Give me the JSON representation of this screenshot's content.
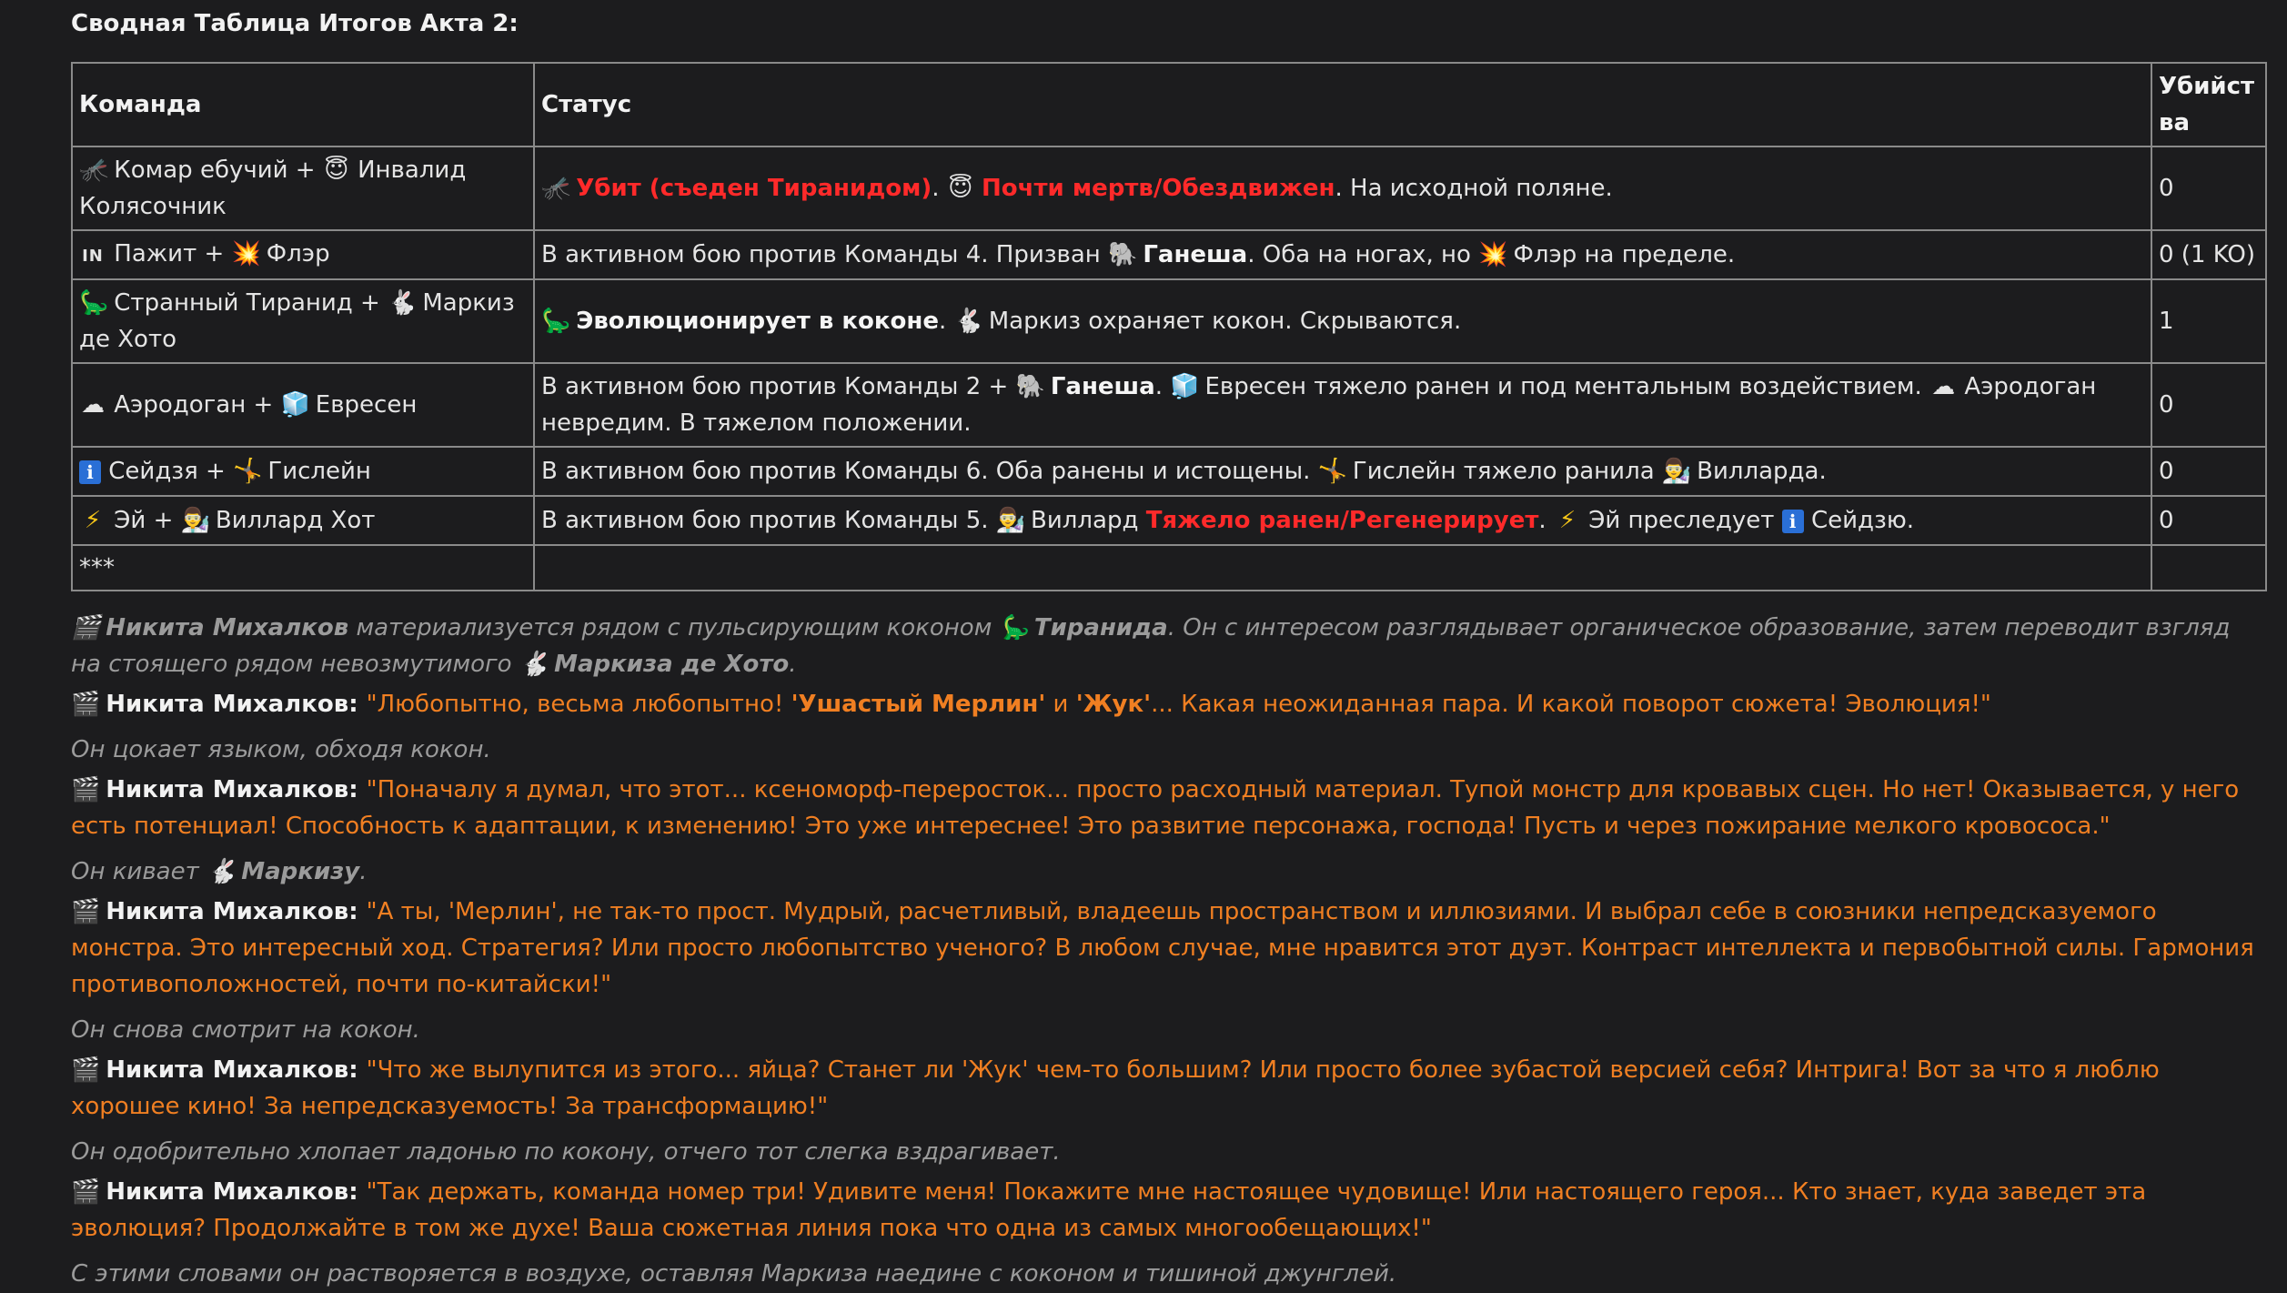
{
  "summary": {
    "heading": "Сводная Таблица Итогов Акта 2:",
    "columns": [
      "Команда",
      "Статус",
      "Убийства"
    ],
    "rows": [
      {
        "team": [
          "🦟",
          " Комар ебучий + ",
          "😇",
          " Инвалид Колясочник"
        ],
        "status": [
          "🦟",
          " ",
          "Убит (съеден Тиранидом)",
          ". ",
          "😇",
          " ",
          "Почти мертв/Обездвижен",
          ". На исходной поляне."
        ],
        "kills": "0"
      },
      {
        "team": [
          "IN",
          " Пажит + ",
          "💥",
          " Флэр"
        ],
        "status": [
          "В активном бою против Команды 4. Призван ",
          "🐘",
          " ",
          "Ганеша",
          ". Оба на ногах, но ",
          "💥",
          " Флэр на пределе."
        ],
        "kills": "0 (1 KO)"
      },
      {
        "team": [
          "🦕",
          " Странный Тиранид + ",
          "🐇",
          " Маркиз де Хото"
        ],
        "status": [
          "🦕",
          " ",
          "Эволюционирует в коконе",
          ". ",
          "🐇",
          " Маркиз охраняет кокон. Скрываются."
        ],
        "kills": "1"
      },
      {
        "team": [
          "☁",
          " Аэродоган + ",
          "🧊",
          " Евресен"
        ],
        "status": [
          "В активном бою против Команды 2 + ",
          "🐘",
          " ",
          "Ганеша",
          ". ",
          "🧊",
          " Евресен тяжело ранен и под ментальным воздействием. ",
          "☁",
          " Аэродоган невредим. В тяжелом положении."
        ],
        "kills": "0"
      },
      {
        "team": [
          "ℹ",
          " Сейдзя + ",
          "🤸",
          " Гислейн"
        ],
        "status": [
          "В активном бою против Команды 6. Оба ранены и истощены. ",
          "🤸",
          " Гислейн тяжело ранила ",
          "👨‍🔬",
          " Вилларда."
        ],
        "kills": "0"
      },
      {
        "team": [
          "⚡",
          " Эй + ",
          "👨‍🔬",
          " Виллард Хот"
        ],
        "status": [
          "В активном бою против Команды 5. ",
          "👨‍🔬",
          " Виллард ",
          "Тяжело ранен/Регенерирует",
          ". ",
          "⚡",
          " Эй преследует ",
          "ℹ",
          " Сейдзю."
        ],
        "kills": "0"
      }
    ],
    "separator": "***"
  },
  "story": {
    "n1": [
      "🎬",
      " ",
      "Никита Михалков",
      " материализуется рядом с пульсирующим коконом ",
      "🦕",
      " ",
      "Тиранида",
      ". Он с интересом разглядывает органическое образование, затем переводит взгляд на стоящего рядом невозмутимого ",
      "🐇",
      " ",
      "Маркиза де Хото",
      "."
    ],
    "s1": [
      "🎬",
      " ",
      "Никита Михалков",
      ": ",
      "\"Любопытно, весьма любопытно! ",
      "'Ушастый Мерлин'",
      " и ",
      "'Жук'",
      "... Какая неожиданная пара. И какой поворот сюжета! Эволюция!\""
    ],
    "n2": "Он цокает языком, обходя кокон.",
    "s2": [
      "🎬",
      " ",
      "Никита Михалков",
      ": ",
      "\"Поначалу я думал, что этот... ксеноморф-переросток... просто расходный материал. Тупой монстр для кровавых сцен. Но нет! Оказывается, у него есть потенциал! Способность к адаптации, к изменению! Это уже интереснее! Это развитие персонажа, господа! Пусть и через пожирание мелкого кровососа.\""
    ],
    "n3": [
      "Он кивает ",
      "🐇",
      " ",
      "Маркизу",
      "."
    ],
    "s3": [
      "🎬",
      " ",
      "Никита Михалков",
      ": ",
      "\"А ты, 'Мерлин', не так-то прост. Мудрый, расчетливый, владеешь пространством и иллюзиями. И выбрал себе в союзники непредсказуемого монстра. Это интересный ход. Стратегия? Или просто любопытство ученого? В любом случае, мне нравится этот дуэт. Контраст интеллекта и первобытной силы. Гармония противоположностей, почти по-китайски!\""
    ],
    "n4": "Он снова смотрит на кокон.",
    "s4": [
      "🎬",
      " ",
      "Никита Михалков",
      ": ",
      "\"Что же вылупится из этого... яйца? Станет ли 'Жук' чем-то большим? Или просто более зубастой версией себя? Интрига! Вот за что я люблю хорошее кино! За непредсказуемость! За трансформацию!\""
    ],
    "n5": "Он одобрительно хлопает ладонью по кокону, отчего тот слегка вздрагивает.",
    "s5": [
      "🎬",
      " ",
      "Никита Михалков",
      ": ",
      "\"Так держать, команда номер три! Удивите меня! Покажите мне настоящее чудовище! Или настоящего героя... Кто знает, куда заведет эта эволюция? Продолжайте в том же духе! Ваша сюжетная линия пока что одна из самых многообещающих!\""
    ],
    "n6": "С этими словами он растворяется в воздухе, оставляя Маркиза наедине с коконом и тишиной джунглей."
  },
  "colors": {
    "background": "#1c1c1e",
    "text": "#e4e4e4",
    "border": "#8a8a8a",
    "highlight_red": "#ff2a2a",
    "speech_orange": "#f07f22",
    "narration_gray": "#9b9b9b"
  }
}
